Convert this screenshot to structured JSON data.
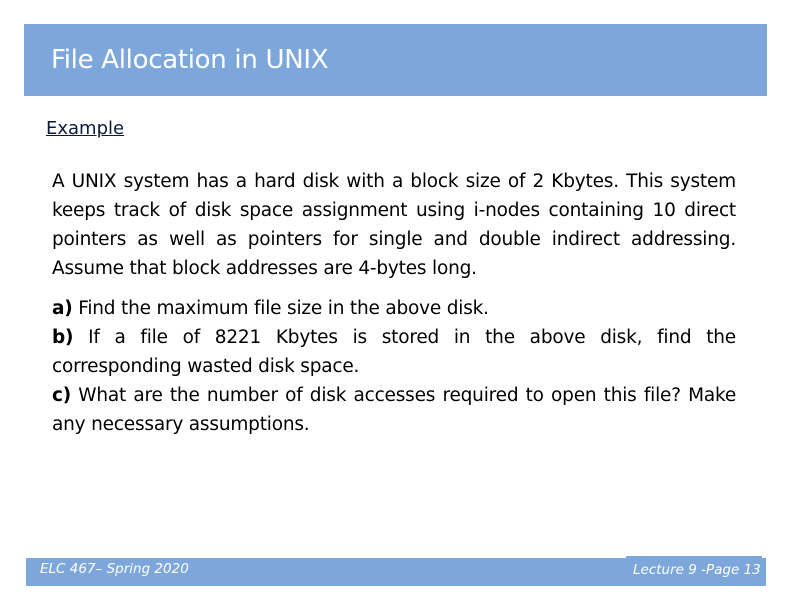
{
  "header": {
    "title": "File Allocation in UNIX"
  },
  "subheading": "Example",
  "body": {
    "paragraph": "A UNIX system has a hard disk with a block size of 2 Kbytes. This system keeps track of disk space assignment using i-nodes containing 10 direct pointers as well as pointers for single and double indirect addressing.  Assume that block addresses are 4-bytes long.",
    "questions": [
      {
        "label": "a)",
        "text": " Find the maximum file size in the above disk."
      },
      {
        "label": "b)",
        "text": " If a file of 8221 Kbytes is stored in the above disk, find the corresponding wasted disk space."
      },
      {
        "label": "c)",
        "text": " What are the number of disk accesses required to open this file? Make any necessary assumptions."
      }
    ]
  },
  "footer": {
    "course": "ELC 467– Spring 2020",
    "page": "Lecture 9 -Page 13"
  },
  "colors": {
    "accent": "#7da7da"
  }
}
